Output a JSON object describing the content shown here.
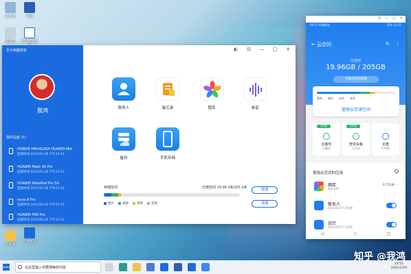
{
  "desktop": {
    "icons": [
      {
        "label": "此电脑"
      },
      {
        "label": "文档"
      },
      {
        "label": "回收站"
      },
      {
        "label": "华为电脑管家"
      },
      {
        "label": "文件夹"
      },
      {
        "label": "应用市场"
      }
    ]
  },
  "manager": {
    "title": "华为电脑管家",
    "username": "我鸿",
    "device_list_title": "我的设备 (5)",
    "devices": [
      {
        "name": "HONOR HRY-AL00A HUAWEI Mat",
        "time": "连接时间 2021/01/18 下午23:31"
      },
      {
        "name": "HUAWEI Mate 40 Pro",
        "time": "连接时间 2021/01/18 下午23:31"
      },
      {
        "name": "HUAWEI MatePad Pro 5G",
        "time": "连接时间 2021/01/18 下午23:31"
      },
      {
        "name": "nova 8 Pro",
        "time": "连接时间 2021/01/16 下午21:15"
      },
      {
        "name": "HUAWEI P40 Pro",
        "time": "连接时间 2021/01/16 下午21:02"
      }
    ],
    "window_controls": [
      "◐",
      "⊟",
      "—",
      "□",
      "✕"
    ],
    "features": [
      {
        "label": "联系人"
      },
      {
        "label": "备忘录"
      },
      {
        "label": "图库"
      },
      {
        "label": "录音"
      },
      {
        "label": "备份"
      },
      {
        "label": "手机存储"
      }
    ],
    "storage": {
      "label": "存储空间",
      "numbers": "已用空间 19.96 GB/205 GB",
      "legend": [
        "图片",
        "视频",
        "音频",
        "其他"
      ],
      "used_fraction": 0.1,
      "manage_label": "管理",
      "clean_label": "清理"
    }
  },
  "phone": {
    "status_left": "06:15 中国移动",
    "status_right": "32% 22:55",
    "nav_title": "云空间",
    "nav_icons": [
      "↻",
      "⋮"
    ],
    "used_label": "已使用",
    "quota": "19.96GB / 205GB",
    "upgrade": "升级云空间容量",
    "legend": [
      "图库",
      "备份",
      "应用",
      "其他"
    ],
    "manage": "管理云存储空间",
    "tiles": [
      {
        "badge": "已开启",
        "title": "云备份",
        "sub": "已备份"
      },
      {
        "badge": "已开启",
        "title": "查找设备",
        "sub": "已开启"
      },
      {
        "badge": "",
        "title": "云盘",
        "sub": "0.00B"
      }
    ],
    "apps_header": "使用云空间的应用",
    "apps": [
      {
        "name": "图库",
        "sub": "照片文件",
        "right": "6.55GB ›"
      },
      {
        "name": "联系人",
        "sub": "2021/01/17 已同步",
        "right": ""
      },
      {
        "name": "日历",
        "sub": "2021/01/17 已同步",
        "right": ""
      }
    ],
    "navbar": [
      "◁",
      "○",
      "□"
    ],
    "titlebar_controls": [
      "⊡",
      "—",
      "□",
      "✕"
    ]
  },
  "watermark": "知乎 @我鸿",
  "taskbar": {
    "search_placeholder": "在这里输入你要搜索的内容",
    "time": "22:55",
    "date": "2021/1/19"
  }
}
